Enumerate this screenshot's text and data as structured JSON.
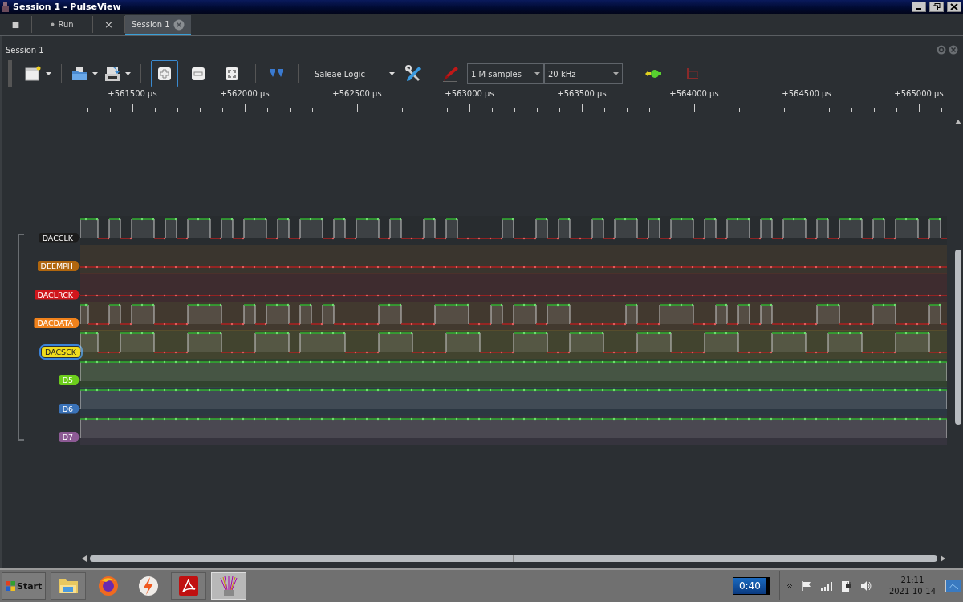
{
  "window": {
    "title": "Session 1 - PulseView"
  },
  "tabs": [
    {
      "kind": "stop",
      "label": "■",
      "selected": false
    },
    {
      "kind": "run",
      "label": "Run",
      "selected": false
    },
    {
      "kind": "plain",
      "label": "×",
      "selected": false
    },
    {
      "kind": "session",
      "label": "Session 1",
      "selected": true
    }
  ],
  "panel": {
    "title": "Session 1"
  },
  "toolbar": {
    "device": "Saleae Logic",
    "samples": "1 M samples",
    "rate": "20 kHz"
  },
  "ruler": {
    "labels": [
      "+561500 µs",
      "+562000 µs",
      "+562500 µs",
      "+563000 µs",
      "+563500 µs",
      "+564000 µs",
      "+564500 µs",
      "+565000 µs"
    ]
  },
  "signals": [
    {
      "name": "DACCLK",
      "color": "#1c1c1c",
      "kind": "fast",
      "selected": false
    },
    {
      "name": "DEEMPH",
      "color": "#b0660e",
      "kind": "low",
      "selected": false
    },
    {
      "name": "DACLRCK",
      "color": "#d0161c",
      "kind": "low",
      "selected": false
    },
    {
      "name": "DACDATA",
      "color": "#f0821c",
      "kind": "data",
      "selected": false
    },
    {
      "name": "DACSCK",
      "color": "#f0dc1c",
      "kind": "slow",
      "selected": true
    },
    {
      "name": "D5",
      "color": "#6ccc1c",
      "kind": "high",
      "selected": false
    },
    {
      "name": "D6",
      "color": "#3a72b8",
      "kind": "high",
      "selected": false
    },
    {
      "name": "D7",
      "color": "#8c5a94",
      "kind": "high",
      "selected": false
    }
  ],
  "taskbar": {
    "start": "Start",
    "apps": [
      {
        "kind": "folder",
        "selected": false
      },
      {
        "kind": "browser",
        "selected": false
      },
      {
        "kind": "lightning",
        "selected": false
      },
      {
        "kind": "pdf",
        "selected": false
      },
      {
        "kind": "probe",
        "selected": true
      }
    ],
    "battery": "0:40",
    "time": "21:11",
    "date": "2021-10-14"
  }
}
